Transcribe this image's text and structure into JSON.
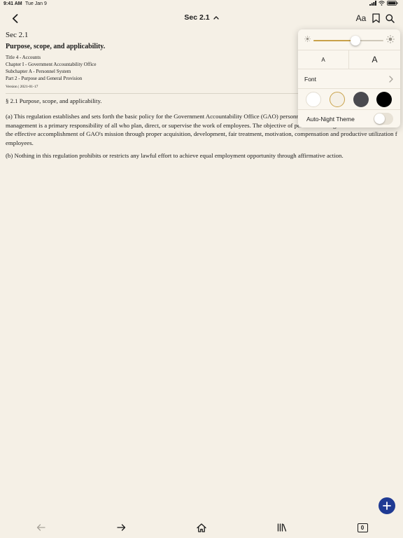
{
  "status_bar": {
    "time": "9:41 AM",
    "date": "Tue Jan 9"
  },
  "nav": {
    "title": "Sec 2.1",
    "aa_label": "Aa"
  },
  "document": {
    "section_number": "Sec 2.1",
    "heading": "Purpose, scope, and applicability.",
    "hierarchy": [
      "Title 4 - Accounts",
      "Chapter I - Government Accountability Office",
      "Subchapter A - Personnel System",
      "Part 2 - Purpose and General Provision"
    ],
    "version": "Version | 2021-01-17",
    "section_title": "§ 2.1 Purpose, scope, and applicability.",
    "paragraphs": [
      "(a) This regulation establishes and sets forth the basic policy for the Government Accountability Office (GAO) personnel management system. Personnel management is a primary responsibility of all who plan, direct, or supervise the work of employees. The objective of personnel management is to contribute to the effective accomplishment of GAO's mission through proper acquisition, development, fair treatment, motivation, compensation and productive utilization f employees.",
      "(b) Nothing in this regulation prohibits or restricts any lawful effort to achieve equal employment opportunity through affirmative action."
    ]
  },
  "appearance_popover": {
    "brightness": 0.6,
    "font_size_small_label": "A",
    "font_size_large_label": "A",
    "font_label": "Font",
    "themes": [
      {
        "name": "white",
        "color": "#ffffff",
        "selected": false
      },
      {
        "name": "sepia",
        "color": "#f5f0e6",
        "selected": true
      },
      {
        "name": "gray",
        "color": "#4a4a4f",
        "selected": false
      },
      {
        "name": "black",
        "color": "#000000",
        "selected": false
      }
    ],
    "auto_night_label": "Auto-Night Theme",
    "auto_night_on": false
  },
  "bottom_bar": {
    "tab_count": "0"
  },
  "colors": {
    "background": "#f5f0e6",
    "accent_fab": "#1f3a93",
    "slider_fill": "#c9a24a",
    "back_arrow_disabled": "#a8a39a"
  },
  "icons": [
    "back-chevron-icon",
    "chevron-up-icon",
    "bookmark-icon",
    "search-icon",
    "sun-icon",
    "chevron-right-icon",
    "plus-icon",
    "arrow-left-icon",
    "arrow-right-icon",
    "home-icon",
    "library-icon"
  ]
}
